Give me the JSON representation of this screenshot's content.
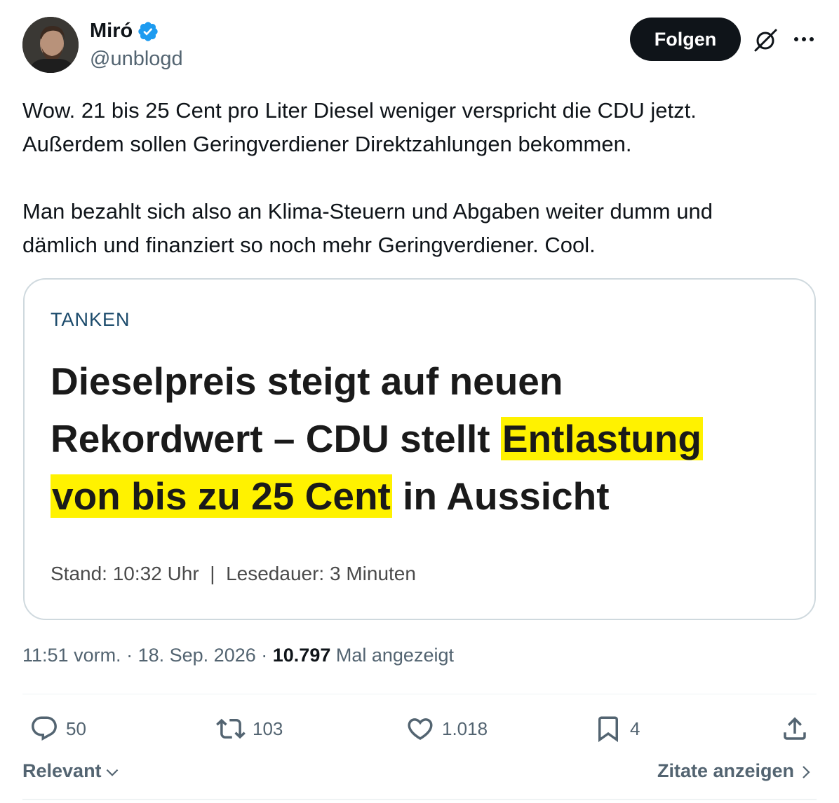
{
  "author": {
    "display_name": "Miró",
    "handle": "@unblogd",
    "verified": true
  },
  "follow_label": "Folgen",
  "tweet": {
    "lines": [
      "Wow. 21 bis 25 Cent pro Liter Diesel weniger verspricht die CDU jetzt.",
      "Außerdem sollen Geringverdiener Direktzahlungen bekommen.",
      "Man bezahlt sich also an Klima-Steuern und Abgaben weiter dumm und",
      "dämlich und finanziert so noch mehr Geringverdiener. Cool."
    ]
  },
  "card": {
    "kicker": "TANKEN",
    "headline": {
      "line1": "Dieselpreis steigt auf neuen",
      "line2_plain": "Rekordwert – CDU stellt ",
      "line2_highlight": "Entlastung",
      "line3_highlight": "von bis zu 25 Cent",
      "line3_plain": " in Aussicht"
    },
    "meta": "Stand: 10:32 Uhr  |  Lesedauer: 3 Minuten"
  },
  "meta": {
    "time": "11:51 vorm.",
    "date": "18. Sep. 2026",
    "views": "10.797",
    "views_suffix": "Mal angezeigt"
  },
  "actions": {
    "replies": "50",
    "reposts": "103",
    "likes": "1.018",
    "bookmarks": "4"
  },
  "footer": {
    "sort_label": "Relevant",
    "quotes_label": "Zitate anzeigen"
  },
  "colors": {
    "verified": "#1d9bf0",
    "highlight": "#fff200",
    "kicker": "#1b4a6b",
    "muted": "#536471"
  }
}
